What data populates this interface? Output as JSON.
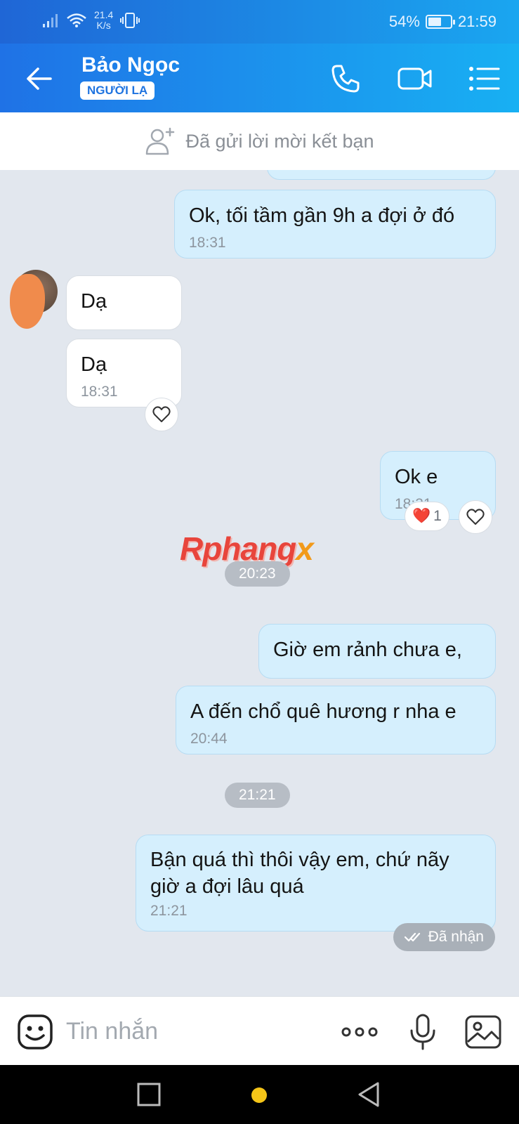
{
  "status_bar": {
    "network_speed_value": "21.4",
    "network_speed_unit": "K/s",
    "battery_percent": "54%",
    "battery_level": 0.54,
    "time": "21:59"
  },
  "header": {
    "contact_name": "Bảo Ngọc",
    "stranger_badge": "NGƯỜI LẠ"
  },
  "friend_request": {
    "text": "Đã gửi lời mời kết bạn"
  },
  "messages": [
    {
      "direction": "out",
      "text": "Ok, tối tầm gần 9h a đợi ở đó",
      "time": "18:31"
    },
    {
      "direction": "in",
      "text": "Dạ",
      "time": ""
    },
    {
      "direction": "in",
      "text": "Dạ",
      "time": "18:31"
    },
    {
      "direction": "out",
      "text": "Ok e",
      "time": "18:31",
      "reaction": {
        "emoji": "❤️",
        "count": "1"
      }
    },
    {
      "direction": "out",
      "text": "Giờ em rảnh chưa e,",
      "time": ""
    },
    {
      "direction": "out",
      "text": "A đến chổ quê hương r nha e",
      "time": "20:44"
    },
    {
      "direction": "out",
      "text": "Bận quá thì thôi vậy em, chứ nãy\ngiờ a đợi lâu quá",
      "time": "21:21"
    }
  ],
  "time_chips": [
    "20:23",
    "21:21"
  ],
  "watermark": {
    "main": "Rphang",
    "suffix": "x"
  },
  "delivery_status": "Đã nhận",
  "input": {
    "placeholder": "Tin nhắn"
  },
  "colors": {
    "header_gradient_start": "#1f72e6",
    "header_gradient_end": "#18b0f3",
    "outgoing_bubble": "#d5effd",
    "incoming_bubble": "#ffffff",
    "chat_background": "#e2e7ee",
    "accent_dot": "#f5c518"
  },
  "icons": {
    "back": "arrow-left-icon",
    "call": "phone-icon",
    "video": "video-camera-icon",
    "menu": "list-menu-icon",
    "add_friend": "add-user-icon",
    "emoji": "emoji-icon",
    "more": "more-dots-icon",
    "mic": "microphone-icon",
    "gallery": "image-icon",
    "like": "heart-icon",
    "seen": "double-check-icon"
  }
}
